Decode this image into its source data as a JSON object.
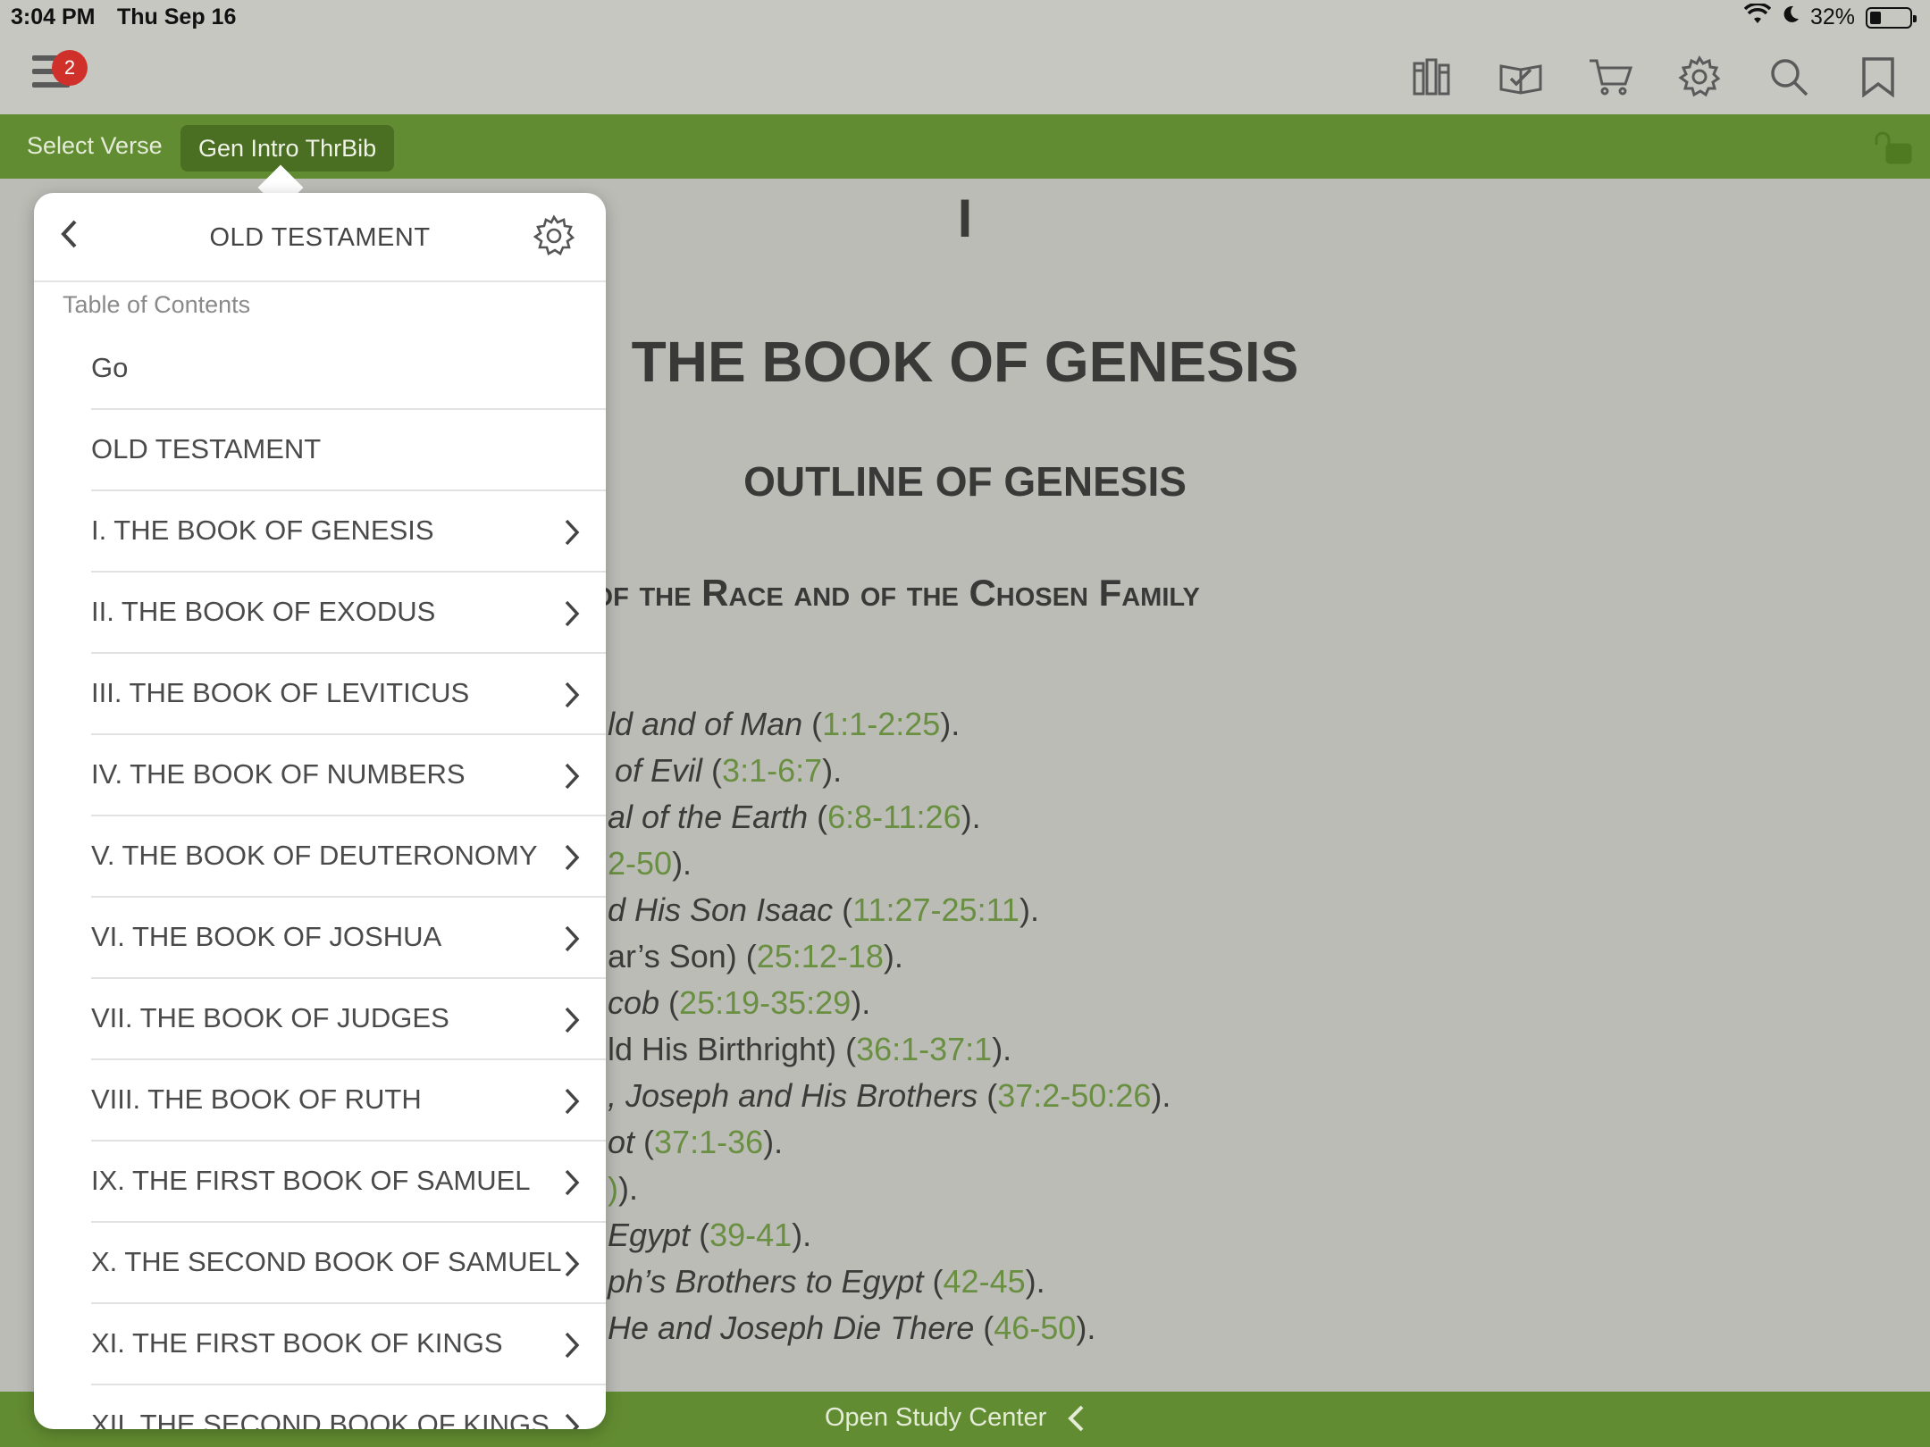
{
  "status": {
    "time": "3:04 PM",
    "date": "Thu Sep 16",
    "battery": "32%"
  },
  "toolbar": {
    "badge_count": "2",
    "icons": [
      "library-icon",
      "reading-plan-icon",
      "cart-icon",
      "settings-icon",
      "search-icon",
      "bookmark-icon"
    ]
  },
  "greenbar": {
    "select_verse": "Select Verse",
    "resource": "Gen Intro ThrBib"
  },
  "bottom": {
    "study_center": "Open Study Center"
  },
  "document": {
    "numeral": "I",
    "title": "THE BOOK OF GENESIS",
    "subtitle": "OUTLINE OF GENESIS",
    "heading": "nings of the Race and of the Chosen Family",
    "outline": [
      {
        "pre": "ld and of Man",
        "italic": true,
        "ref": "1:1-2:25"
      },
      {
        "pre": " of Evil",
        "italic": true,
        "ref": "3:1-6:7"
      },
      {
        "pre": "al of the Earth",
        "italic": true,
        "ref": "6:8-11:26"
      },
      {
        "pre": "",
        "italic": false,
        "ref": "2-50"
      },
      {
        "pre": "d His Son Isaac",
        "italic": true,
        "ref": "11:27-25:11"
      },
      {
        "pre": "ar’s Son)",
        "italic": false,
        "ref": "25:12-18"
      },
      {
        "pre": "cob",
        "italic": true,
        "ref": "25:19-35:29"
      },
      {
        "pre": "ld His Birthright)",
        "italic": false,
        "ref": "36:1-37:1"
      },
      {
        "pre": ", Joseph and His Brothers",
        "italic": true,
        "ref": "37:2-50:26"
      },
      {
        "pre": "ot",
        "italic": true,
        "ref": "37:1-36"
      },
      {
        "pre": "",
        "italic": false,
        "ref": ")"
      },
      {
        "pre": "Egypt",
        "italic": true,
        "ref": "39-41"
      },
      {
        "pre": "ph’s Brothers to Egypt",
        "italic": true,
        "ref": "42-45"
      },
      {
        "pre": "He and Joseph Die There",
        "italic": true,
        "ref": "46-50"
      }
    ]
  },
  "popover": {
    "title": "OLD TESTAMENT",
    "toc_label": "Table of Contents",
    "items": [
      {
        "label": "Go",
        "chevron": false
      },
      {
        "label": "OLD TESTAMENT",
        "chevron": false
      },
      {
        "label": "I. THE BOOK OF GENESIS",
        "chevron": true
      },
      {
        "label": "II. THE BOOK OF EXODUS",
        "chevron": true
      },
      {
        "label": "III. THE BOOK OF LEVITICUS",
        "chevron": true
      },
      {
        "label": "IV. THE BOOK OF NUMBERS",
        "chevron": true
      },
      {
        "label": "V. THE BOOK OF DEUTERONOMY",
        "chevron": true
      },
      {
        "label": "VI. THE BOOK OF JOSHUA",
        "chevron": true
      },
      {
        "label": "VII. THE BOOK OF JUDGES",
        "chevron": true
      },
      {
        "label": "VIII. THE BOOK OF RUTH",
        "chevron": true
      },
      {
        "label": "IX. THE FIRST BOOK OF SAMUEL",
        "chevron": true
      },
      {
        "label": "X. THE SECOND BOOK OF SAMUEL",
        "chevron": true
      },
      {
        "label": "XI. THE FIRST BOOK OF KINGS",
        "chevron": true
      },
      {
        "label": "XII. THE SECOND BOOK OF KINGS",
        "chevron": true
      }
    ]
  },
  "colors": {
    "accent_green": "#628c31",
    "ref_green": "#5d8d2b",
    "badge_red": "#d0302a"
  }
}
